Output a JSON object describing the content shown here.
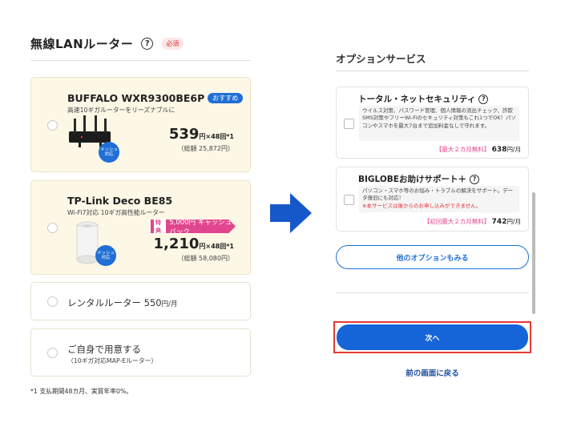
{
  "left": {
    "title": "無線LANルーター",
    "help": "?",
    "required_badge": "必須",
    "cards": {
      "buffalo": {
        "name": "BUFFALO WXR9300BE6P",
        "badge": "おすすめ",
        "sub": "高速10ギガルーターをリーズナブルに",
        "price": "539",
        "price_unit": "円×48回*1",
        "total": "（総額 25,872円）",
        "mesh": "メッシュ対応"
      },
      "tplink": {
        "name": "TP-Link Deco BE85",
        "sub": "Wi-Fi7対応 10ギガ高性能ルーター",
        "cashback_tag": "特典",
        "cashback": "5,000円 キャッシュバック",
        "price": "1,210",
        "price_unit": "円×48回*1",
        "total": "（総額 58,080円）",
        "mesh": "メッシュ対応"
      },
      "rental": {
        "label": "レンタルルーター 550",
        "unit": "円/月"
      },
      "own": {
        "label": "ご自身で用意する",
        "sub": "（10ギガ対応MAP-Eルーター）"
      }
    },
    "footnote": "*1 支払期間48カ月、実質年率0%。"
  },
  "right": {
    "title": "オプションサービス",
    "options": {
      "security": {
        "title": "トータル・ネットセキュリティ",
        "help": "?",
        "desc": "ウイルス対策、パスワード管理、個人情報の流出チェック、詐欺SMS対策やフリーWi-Fiのセキュリティ対策もこれ1つでOK！パソコンやスマホを最大7台まで追加料金なしで守れます。",
        "promo": "【最大２カ月無料】",
        "price": "638",
        "unit": "円/月"
      },
      "support": {
        "title": "BIGLOBEお助けサポート＋",
        "help": "?",
        "desc": "パソコン・スマホ等のお悩み・トラブルの解決をサポート。データ復旧にも対応！",
        "warn": "※本サービスは後からのお申し込みができません。",
        "promo": "【初回最大２カ月無料】",
        "price": "742",
        "unit": "円/月"
      }
    },
    "more_button": "他のオプションもみる",
    "next_button": "次へ",
    "back_link": "前の画面に戻る"
  },
  "colors": {
    "accent_blue": "#1f6fd6",
    "button_blue": "#1565d8",
    "pink": "#e0468e",
    "highlight_red": "#e53935",
    "card_cream": "#fdf7e6"
  }
}
